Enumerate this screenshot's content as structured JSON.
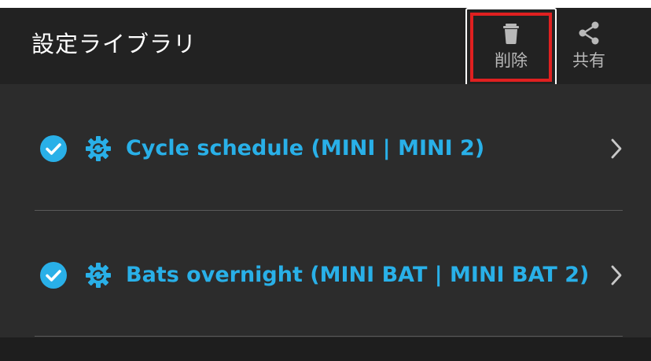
{
  "header": {
    "title": "設定ライブラリ",
    "actions": [
      {
        "label": "削除",
        "icon": "trash-icon",
        "highlighted": true
      },
      {
        "label": "共有",
        "icon": "share-icon"
      }
    ]
  },
  "list": {
    "items": [
      {
        "label": "Cycle schedule (MINI | MINI 2)",
        "selected": true,
        "icon": "gear-sync-icon"
      },
      {
        "label": "Bats overnight (MINI BAT | MINI BAT 2)",
        "selected": true,
        "icon": "gear-sync-icon"
      }
    ]
  },
  "colors": {
    "header_bg": "#222222",
    "list_bg": "#2c2c2c",
    "accent": "#29b0e8",
    "highlight": "#e02020",
    "text_secondary": "#b8b8b8"
  }
}
